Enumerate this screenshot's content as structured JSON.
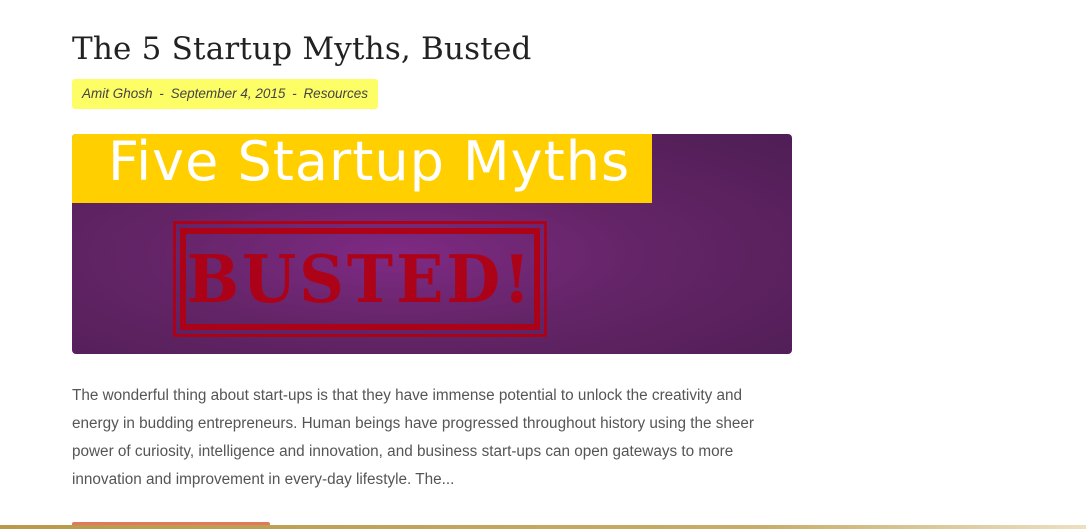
{
  "post": {
    "title": "The 5 Startup Myths, Busted",
    "meta": {
      "author": "Amit Ghosh",
      "separator": "-",
      "date": "September 4, 2015",
      "category": "Resources"
    },
    "image": {
      "headline": "Five Startup Myths",
      "stamp": "BUSTED!",
      "colors": {
        "band": "#ffcf00",
        "background": "#632466",
        "stamp": "#b10012"
      }
    },
    "excerpt": "The wonderful thing about start-ups is that they have immense potential to unlock the creativity and energy in budding entrepreneurs. Human beings have progressed throughout history using the sheer power of curiosity, intelligence and innovation, and business start-ups can open gateways to more innovation and improvement in every-day lifestyle. The..."
  }
}
